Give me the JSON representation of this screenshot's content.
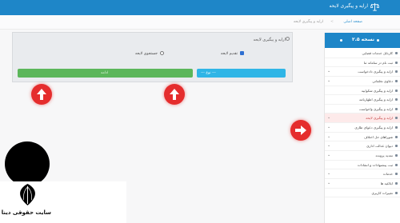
{
  "header": {
    "title": "ارایه و پیگیری لایحه",
    "icon": "scale-icon"
  },
  "breadcrumb": {
    "home": "صفحه اصلی",
    "separator": ">",
    "current": "ارایه و پیگیری لایحه"
  },
  "form": {
    "title": "ارایه و پیگیری لایحه",
    "option_submit": "تقدیم لایحه",
    "option_search": "جستجوی لایحه",
    "select_label": "--- نوع ---",
    "select_chevron": "⌄",
    "action_button": "ادامه"
  },
  "sidebar": {
    "title": "نسخه ۲.۵",
    "items": [
      {
        "label": "کارتابل خدمات قضایی",
        "caret": ""
      },
      {
        "label": "ثبت نام در سامانه ثنا",
        "caret": ""
      },
      {
        "label": "ارایه و پیگیری دادخواست",
        "caret": "⌄"
      },
      {
        "label": "دعاوی تخلفاتی",
        "caret": "⌄"
      },
      {
        "label": "ارایه و پیگیری شکواییه",
        "caret": ""
      },
      {
        "label": "ارایه و پیگیری اظهارنامه",
        "caret": ""
      },
      {
        "label": "ارایه و پیگیری واخواست",
        "caret": ""
      },
      {
        "label": "ارایه و پیگیری لایحه",
        "caret": "⌄"
      },
      {
        "label": "ارایه و پیگیری دعوای طاری",
        "caret": "⌄"
      },
      {
        "label": "شوراهای حل اختلاف",
        "caret": "⌄"
      },
      {
        "label": "دیوان عدالت اداری",
        "caret": "⌄"
      },
      {
        "label": "تمدید پرونده",
        "caret": "⌄"
      },
      {
        "label": "ثبت پیشنهادات و انتقادات",
        "caret": ""
      },
      {
        "label": "خدمات",
        "caret": "⌄"
      },
      {
        "label": "ابلاغیه ها",
        "caret": "⌄"
      },
      {
        "label": "تغییرات کاربری",
        "caret": ""
      }
    ]
  },
  "branding": {
    "site_name": "سایت حقوقی دینا"
  },
  "colors": {
    "header_blue": "#1e86c8",
    "select_blue": "#2fb5e6",
    "button_green": "#5bb65a",
    "pointer_red": "#e52d2d"
  }
}
